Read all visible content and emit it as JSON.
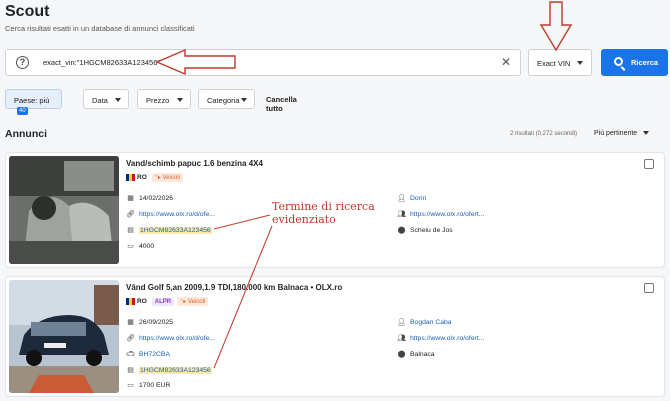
{
  "header": {
    "title": "Scout",
    "subtitle": "Cerca risultati esatti in un database di annunci classificati"
  },
  "search": {
    "query": "exact_vin:\"1HGCM82633A123456\"",
    "mode": "Exact VIN",
    "button_label": "Ricerca"
  },
  "filters": {
    "country_label": "Paese: più",
    "country_count": "40",
    "date_label": "Data",
    "price_label": "Prezzo",
    "category_label": "Categoria",
    "reset_label": "Cancella tutto"
  },
  "results": {
    "section_title": "Annunci",
    "meta": "2 risultati (0.272 secondi)",
    "sort_label": "Più pertinente"
  },
  "listings": [
    {
      "title": "Vand/schimb papuc 1.6 benzina 4X4",
      "country": "RO",
      "category": "Veicoli",
      "date": "14/02/2026",
      "url": "https://www.olx.ro/d/ofe...",
      "vin": "1HGCM82633A123456",
      "price": "4000",
      "seller": "Dorin",
      "profile_url": "https://www.olx.ro/ofert...",
      "location": "Scheiu de Jos"
    },
    {
      "title": "Vând Golf 5,an 2009,1.9 TDI,180.000 km Balnaca • OLX.ro",
      "country": "RO",
      "badge": "ALPR",
      "category": "Veicoli",
      "date": "26/09/2025",
      "url": "https://www.olx.ro/d/ofe...",
      "plate": "BH72CBA",
      "vin": "1HGCM82633A123456",
      "price": "1700 EUR",
      "seller": "Bogdan Caba",
      "profile_url": "https://www.olx.ro/ofert...",
      "location": "Balnaca"
    }
  ],
  "annotation": {
    "line1": "Termine di ricerca",
    "line2": "evidenziato"
  }
}
